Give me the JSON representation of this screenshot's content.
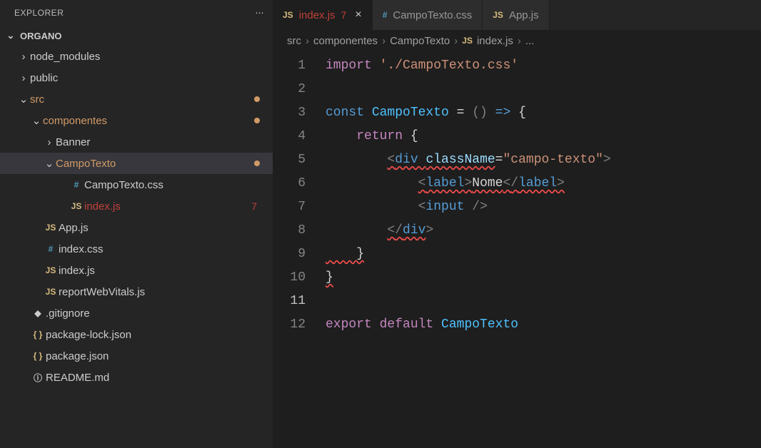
{
  "explorer": {
    "title": "EXPLORER",
    "root": "ORGANO",
    "tree": [
      {
        "kind": "folder",
        "name": "node_modules",
        "open": false,
        "indent": 1
      },
      {
        "kind": "folder",
        "name": "public",
        "open": false,
        "indent": 1
      },
      {
        "kind": "folder",
        "name": "src",
        "open": true,
        "indent": 1,
        "state": "modified"
      },
      {
        "kind": "folder",
        "name": "componentes",
        "open": true,
        "indent": 2,
        "state": "modified"
      },
      {
        "kind": "folder",
        "name": "Banner",
        "open": false,
        "indent": 3
      },
      {
        "kind": "folder",
        "name": "CampoTexto",
        "open": true,
        "indent": 3,
        "state": "modified",
        "active": true
      },
      {
        "kind": "file",
        "name": "CampoTexto.css",
        "icon": "css",
        "indent": 4
      },
      {
        "kind": "file",
        "name": "index.js",
        "icon": "js",
        "indent": 4,
        "state": "error",
        "badge": "7"
      },
      {
        "kind": "file",
        "name": "App.js",
        "icon": "js",
        "indent": 2
      },
      {
        "kind": "file",
        "name": "index.css",
        "icon": "css",
        "indent": 2
      },
      {
        "kind": "file",
        "name": "index.js",
        "icon": "js",
        "indent": 2
      },
      {
        "kind": "file",
        "name": "reportWebVitals.js",
        "icon": "js",
        "indent": 2
      },
      {
        "kind": "file",
        "name": ".gitignore",
        "icon": "git",
        "indent": 1
      },
      {
        "kind": "file",
        "name": "package-lock.json",
        "icon": "json",
        "indent": 1
      },
      {
        "kind": "file",
        "name": "package.json",
        "icon": "json",
        "indent": 1
      },
      {
        "kind": "file",
        "name": "README.md",
        "icon": "info",
        "indent": 1
      }
    ]
  },
  "tabs": [
    {
      "icon": "js",
      "title": "index.js",
      "badge": "7",
      "state": "error",
      "close": true,
      "active": true
    },
    {
      "icon": "css",
      "title": "CampoTexto.css",
      "active": false
    },
    {
      "icon": "js",
      "title": "App.js",
      "active": false
    }
  ],
  "breadcrumbs": [
    "src",
    "componentes",
    "CampoTexto",
    "index.js",
    "..."
  ],
  "bc_icon_at": 3,
  "code": {
    "current_line": 11,
    "lines": [
      [
        {
          "t": "import ",
          "c": "kw"
        },
        {
          "t": "'./CampoTexto.css'",
          "c": "str"
        }
      ],
      [],
      [
        {
          "t": "const ",
          "c": "kw2"
        },
        {
          "t": "CampoTexto",
          "c": "var"
        },
        {
          "t": " = ",
          "c": "pl"
        },
        {
          "t": "()",
          "c": "pun"
        },
        {
          "t": " ",
          "c": "pl"
        },
        {
          "t": "=>",
          "c": "kw2"
        },
        {
          "t": " {",
          "c": "pl"
        }
      ],
      [
        {
          "t": "    ",
          "c": "pl"
        },
        {
          "t": "return",
          "c": "kw"
        },
        {
          "t": " {",
          "c": "pl"
        }
      ],
      [
        {
          "t": "        ",
          "c": "pl"
        },
        {
          "t": "<",
          "c": "pun",
          "u": 1
        },
        {
          "t": "div ",
          "c": "tag",
          "u": 1
        },
        {
          "t": "className",
          "c": "attr",
          "u": 1
        },
        {
          "t": "=",
          "c": "pl"
        },
        {
          "t": "\"campo-texto\"",
          "c": "str"
        },
        {
          "t": ">",
          "c": "pun"
        }
      ],
      [
        {
          "t": "            ",
          "c": "pl"
        },
        {
          "t": "<",
          "c": "pun",
          "u": 1
        },
        {
          "t": "label",
          "c": "tag",
          "u": 1
        },
        {
          "t": ">",
          "c": "pun",
          "u": 1
        },
        {
          "t": "Nome",
          "c": "txt",
          "u": 1
        },
        {
          "t": "<",
          "c": "pun",
          "u": 1
        },
        {
          "t": "/",
          "c": "pun",
          "u": 1
        },
        {
          "t": "label",
          "c": "tag",
          "u": 1
        },
        {
          "t": ">",
          "c": "pun",
          "u": 1
        }
      ],
      [
        {
          "t": "            ",
          "c": "pl"
        },
        {
          "t": "<",
          "c": "pun"
        },
        {
          "t": "input",
          "c": "tag"
        },
        {
          "t": " ",
          "c": "pl"
        },
        {
          "t": "/>",
          "c": "pun"
        }
      ],
      [
        {
          "t": "        ",
          "c": "pl"
        },
        {
          "t": "<",
          "c": "pun",
          "u": 1
        },
        {
          "t": "/",
          "c": "pun",
          "u": 1
        },
        {
          "t": "div",
          "c": "tag",
          "u": 1
        },
        {
          "t": ">",
          "c": "pun"
        }
      ],
      [
        {
          "t": "    }",
          "c": "pl",
          "u": 1
        }
      ],
      [
        {
          "t": "}",
          "c": "pl",
          "u": 1
        }
      ],
      [],
      [
        {
          "t": "export ",
          "c": "kw"
        },
        {
          "t": "default ",
          "c": "kw"
        },
        {
          "t": "CampoTexto",
          "c": "var"
        }
      ]
    ]
  }
}
